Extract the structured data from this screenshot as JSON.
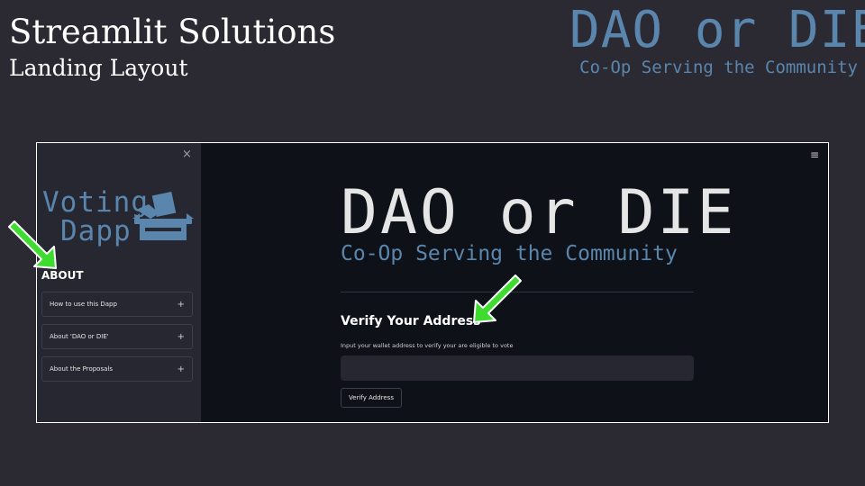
{
  "slide": {
    "title": "Streamlit Solutions",
    "subtitle": "Landing Layout",
    "brand_title": "DAO or DIE",
    "brand_tagline": "Co-Op Serving the Community"
  },
  "app": {
    "sidebar": {
      "close_symbol": "×",
      "logo_line1": "Voting",
      "logo_line2": "Dapp",
      "section_heading": "ABOUT",
      "expanders": [
        {
          "label": "How to use this Dapp",
          "icon": "+"
        },
        {
          "label": "About 'DAO or DIE'",
          "icon": "+"
        },
        {
          "label": "About the Proposals",
          "icon": "+"
        }
      ]
    },
    "menu_symbol": "≡",
    "main": {
      "title": "DAO or DIE",
      "tagline": "Co-Op Serving the Community",
      "verify_heading": "Verify Your Address",
      "input_label": "Input your wallet address to verify your are eligible to vote",
      "input_value": "",
      "verify_button": "Verify Address"
    }
  },
  "icons": {
    "logo_icon": "ballot-box-icon",
    "annotations": "green-arrow-icon"
  },
  "colors": {
    "slide_bg": "#2b2a33",
    "brand_blue": "#5a86ad",
    "sidebar_bg": "#262730",
    "app_bg": "#0e1117",
    "arrow_green": "#3ddc2f"
  }
}
